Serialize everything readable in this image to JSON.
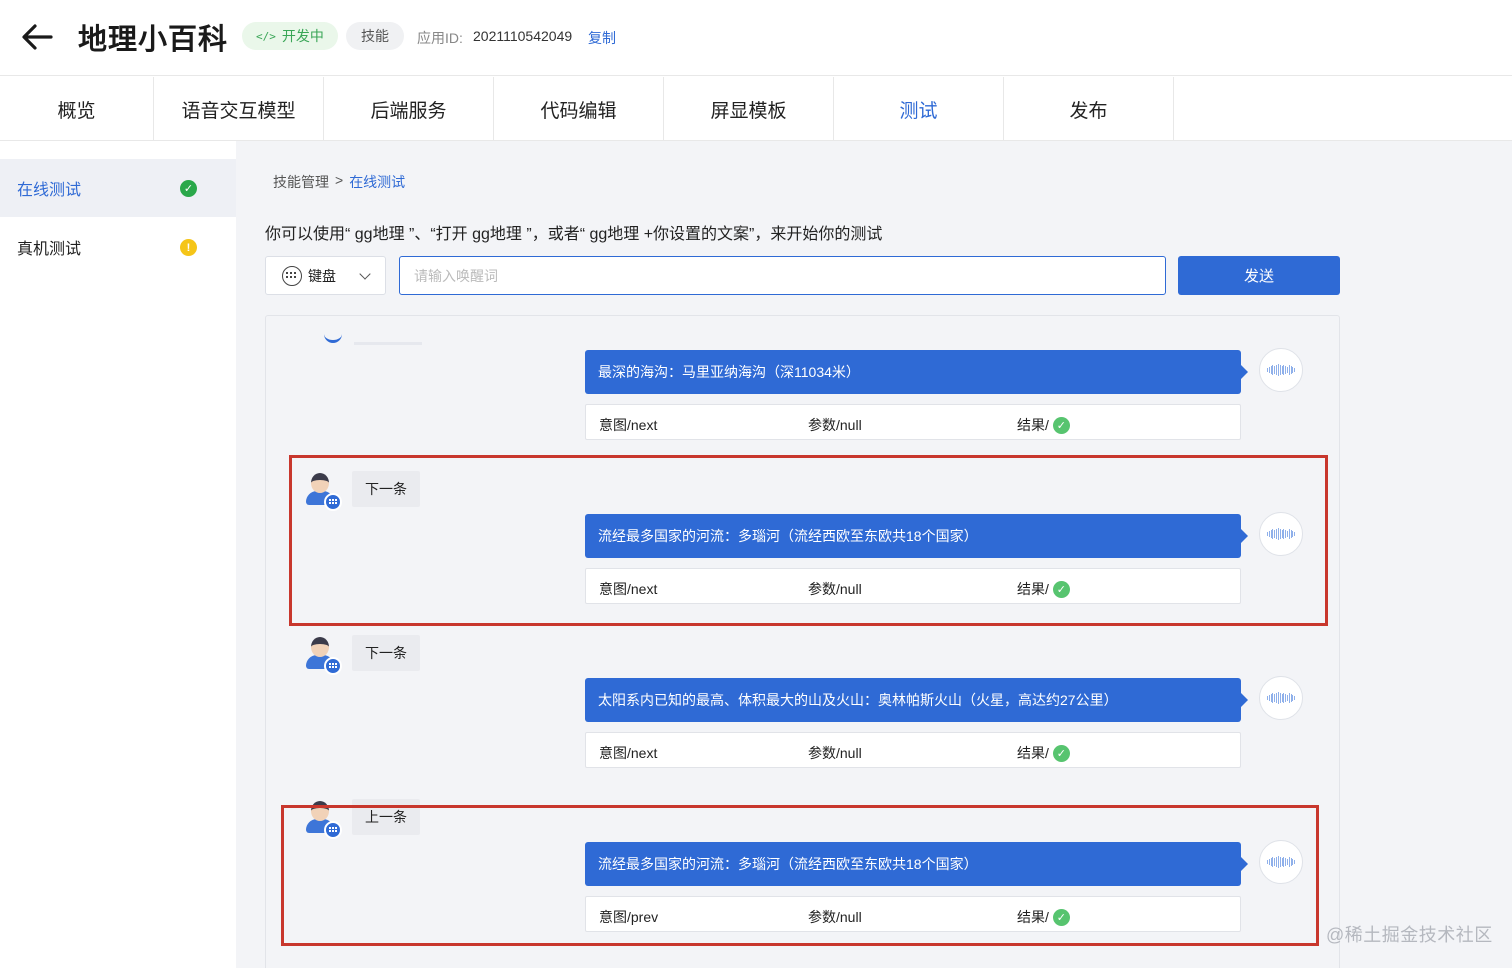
{
  "header": {
    "title": "地理小百科",
    "status_badge": "开发中",
    "type_badge": "技能",
    "app_id_label": "应用ID:",
    "app_id": "2021110542049",
    "copy_label": "复制"
  },
  "tabs": [
    {
      "label": "概览",
      "active": false
    },
    {
      "label": "语音交互模型",
      "active": false
    },
    {
      "label": "后端服务",
      "active": false
    },
    {
      "label": "代码编辑",
      "active": false
    },
    {
      "label": "屏显模板",
      "active": false
    },
    {
      "label": "测试",
      "active": true
    },
    {
      "label": "发布",
      "active": false
    }
  ],
  "sidebar": {
    "items": [
      {
        "label": "在线测试",
        "status": "ok",
        "active": true
      },
      {
        "label": "真机测试",
        "status": "warn",
        "active": false
      }
    ]
  },
  "breadcrumb": {
    "parent": "技能管理",
    "separator": ">",
    "current": "在线测试"
  },
  "instruction": "你可以使用“ gg地理 ”、“打开 gg地理 ”，或者“ gg地理 +你设置的文案”，来开始你的测试",
  "input": {
    "mode_label": "键盘",
    "placeholder": "请输入唤醒词",
    "value": "",
    "send_label": "发送"
  },
  "conversation": [
    {
      "user_text": "",
      "bot_text": "最深的海沟：马里亚纳海沟（深11034米）",
      "intent": "意图/next",
      "params": "参数/null",
      "result_label": "结果/",
      "result_ok": true
    },
    {
      "user_text": "下一条",
      "bot_text": "流经最多国家的河流：多瑙河（流经西欧至东欧共18个国家）",
      "intent": "意图/next",
      "params": "参数/null",
      "result_label": "结果/",
      "result_ok": true,
      "highlighted": true
    },
    {
      "user_text": "下一条",
      "bot_text": "太阳系内已知的最高、体积最大的山及火山：奥林帕斯火山（火星，高达约27公里）",
      "intent": "意图/next",
      "params": "参数/null",
      "result_label": "结果/",
      "result_ok": true
    },
    {
      "user_text": "上一条",
      "bot_text": "流经最多国家的河流：多瑙河（流经西欧至东欧共18个国家）",
      "intent": "意图/prev",
      "params": "参数/null",
      "result_label": "结果/",
      "result_ok": true,
      "highlighted": true
    }
  ],
  "watermark": "@稀土掘金技术社区",
  "colors": {
    "accent": "#2f6ad5",
    "success": "#2aa84a",
    "warning": "#f5c518",
    "highlight": "#c8372d"
  }
}
